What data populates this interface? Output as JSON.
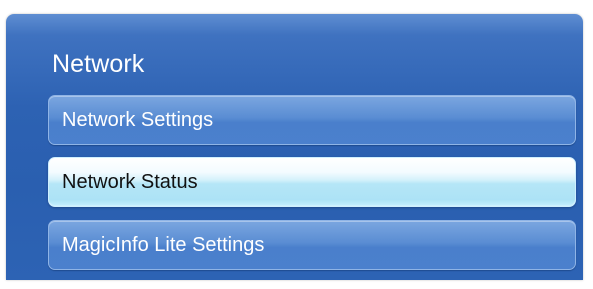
{
  "menu": {
    "title": "Network",
    "items": [
      {
        "label": "Network Settings",
        "selected": false
      },
      {
        "label": "Network Status",
        "selected": true
      },
      {
        "label": "MagicInfo Lite Settings",
        "selected": false
      }
    ]
  },
  "colors": {
    "panel_blue": "#2d62b3",
    "item_blue": "#5a8dd3",
    "selected_highlight": "#b5e6f7",
    "title_text": "#ffffff",
    "selected_text": "#111111"
  }
}
